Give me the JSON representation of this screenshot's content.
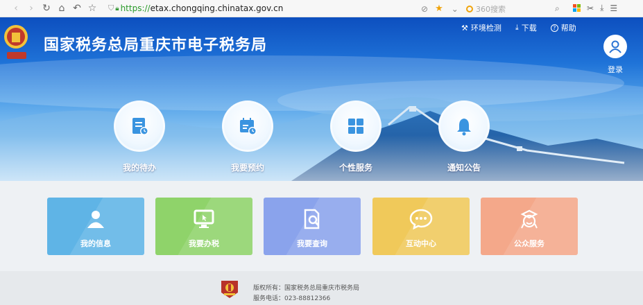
{
  "browser": {
    "url_scheme": "https://",
    "url_host": "etax.chongqing.chinatax.gov.cn",
    "search_placeholder": "360搜索",
    "nav_back": "‹",
    "nav_forward": "›",
    "nav_refresh": "↻",
    "nav_home": "⌂",
    "nav_undo": "↶",
    "nav_favorite": "☆",
    "favorite_star": "★",
    "scissors": "✂",
    "download": "⤓",
    "menu": "☰"
  },
  "header": {
    "site_title": "国家税务总局重庆市电子税务局",
    "links": [
      {
        "icon": "tools-icon",
        "glyph": "⚒",
        "label": "环境检测"
      },
      {
        "icon": "download-icon",
        "glyph": "⤓",
        "label": "下载"
      },
      {
        "icon": "help-icon",
        "glyph": "?",
        "label": "帮助"
      }
    ],
    "login_label": "登录"
  },
  "hero_items": [
    {
      "label": "我的待办",
      "icon": "todo-icon"
    },
    {
      "label": "我要预约",
      "icon": "calendar-icon"
    },
    {
      "label": "个性服务",
      "icon": "grid-icon"
    },
    {
      "label": "通知公告",
      "icon": "bell-icon"
    }
  ],
  "tiles": [
    {
      "label": "我的信息",
      "icon": "user-icon",
      "color": "#5fb4e6"
    },
    {
      "label": "我要办税",
      "icon": "monitor-icon",
      "color": "#8fd36a"
    },
    {
      "label": "我要查询",
      "icon": "search-doc-icon",
      "color": "#8aa3ec"
    },
    {
      "label": "互动中心",
      "icon": "chat-icon",
      "color": "#f0c95a"
    },
    {
      "label": "公众服务",
      "icon": "service-icon",
      "color": "#f4a88a"
    }
  ],
  "footer": {
    "copyright": "版权所有：国家税务总局重庆市税务局",
    "phone": "服务电话：023-88812366"
  },
  "colors": {
    "hero_top": "#0d4fbf",
    "hero_bottom": "#a9d6f5",
    "hero_icon_blue": "#3a94e0",
    "emblem_red": "#c0392b",
    "emblem_gold": "#f2c23a"
  }
}
